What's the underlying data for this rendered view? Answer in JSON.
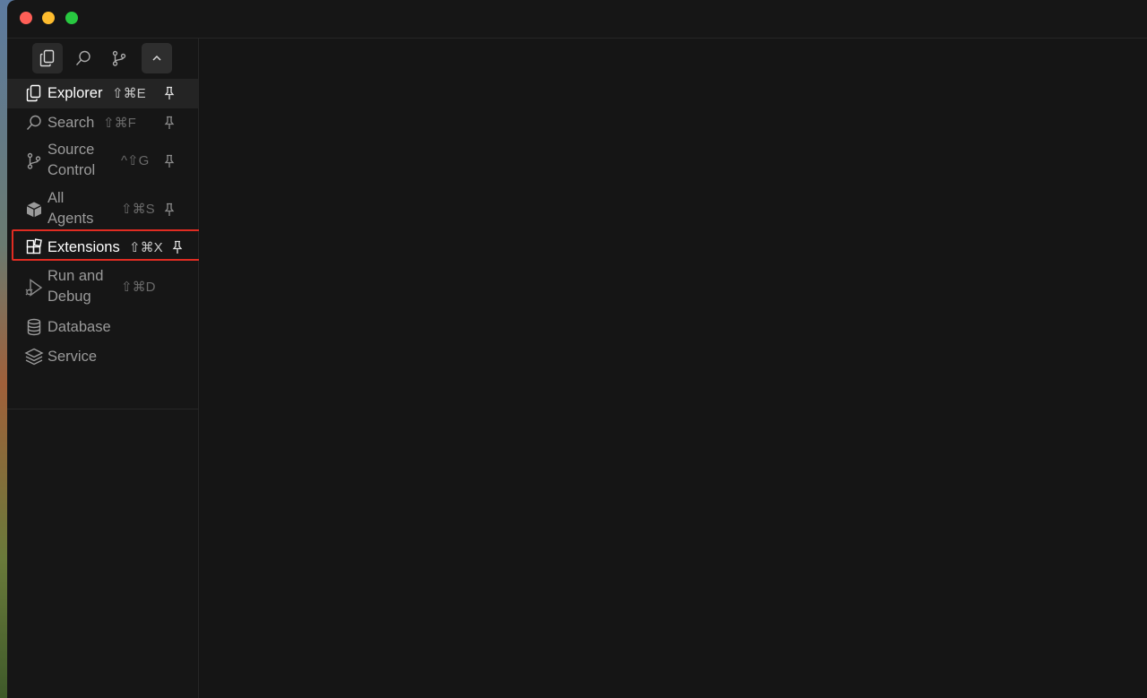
{
  "window": {
    "traffic_lights": [
      {
        "name": "close",
        "color": "#ff5f57"
      },
      {
        "name": "minimize",
        "color": "#febc2e"
      },
      {
        "name": "zoom",
        "color": "#28c840"
      }
    ]
  },
  "activity_bar": {
    "icons": [
      "files-icon",
      "search-icon",
      "source-control-icon",
      "chevron-up-icon"
    ]
  },
  "menu": {
    "items": [
      {
        "id": "explorer",
        "label": "Explorer",
        "shortcut": "⇧⌘E",
        "icon": "files-icon",
        "pinned": true
      },
      {
        "id": "search",
        "label": "Search",
        "shortcut": "⇧⌘F",
        "icon": "search-icon",
        "pinned": true
      },
      {
        "id": "source-control",
        "label_line1": "Source",
        "label_line2": "Control",
        "shortcut": "^⇧G",
        "icon": "source-control-icon",
        "pinned": true
      },
      {
        "id": "all-agents",
        "label_line1": "All",
        "label_line2": "Agents",
        "shortcut": "⇧⌘S",
        "icon": "cube-icon",
        "pinned": true
      },
      {
        "id": "extensions",
        "label": "Extensions",
        "shortcut": "⇧⌘X",
        "icon": "extensions-icon",
        "pinned": true
      },
      {
        "id": "run-debug",
        "label_line1": "Run and",
        "label_line2": "Debug",
        "shortcut": "⇧⌘D",
        "icon": "run-debug-icon",
        "pinned": false
      },
      {
        "id": "database",
        "label": "Database",
        "shortcut": "",
        "icon": "database-icon",
        "pinned": false
      },
      {
        "id": "service",
        "label": "Service",
        "shortcut": "",
        "icon": "layers-icon",
        "pinned": false
      }
    ]
  },
  "colors": {
    "highlight_border": "#e02c22",
    "background": "#151515"
  }
}
